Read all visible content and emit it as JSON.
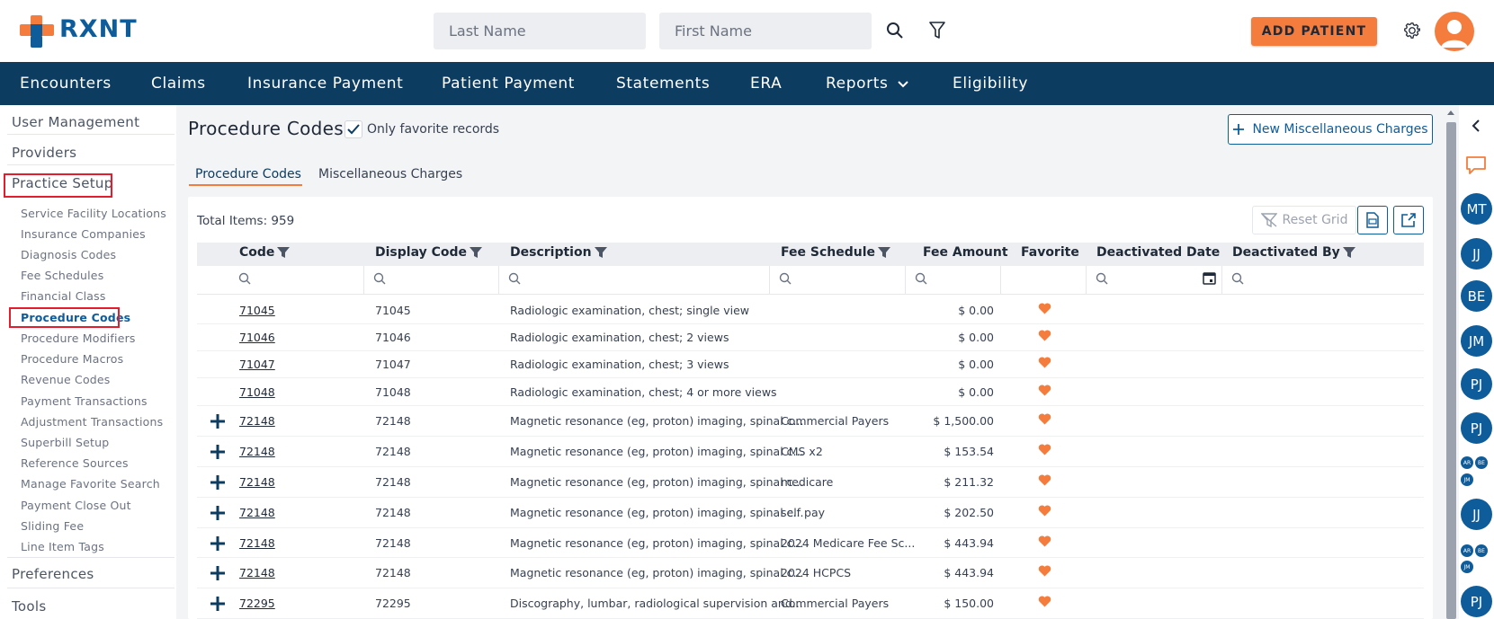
{
  "brand": {
    "name": "RXNT"
  },
  "search": {
    "last_name_placeholder": "Last Name",
    "first_name_placeholder": "First Name"
  },
  "header": {
    "add_patient_label": "ADD PATIENT"
  },
  "nav": {
    "items": [
      "Encounters",
      "Claims",
      "Insurance Payment",
      "Patient Payment",
      "Statements",
      "ERA",
      "Reports",
      "Eligibility"
    ]
  },
  "sidebar": {
    "sections": [
      "User Management",
      "Providers",
      "Practice Setup",
      "Preferences",
      "Tools"
    ],
    "items": [
      "Service Facility Locations",
      "Insurance Companies",
      "Diagnosis Codes",
      "Fee Schedules",
      "Financial Class",
      "Procedure Codes",
      "Procedure Modifiers",
      "Procedure Macros",
      "Revenue Codes",
      "Payment Transactions",
      "Adjustment Transactions",
      "Superbill Setup",
      "Reference Sources",
      "Manage Favorite Search",
      "Payment Close Out",
      "Sliding Fee",
      "Line Item Tags"
    ]
  },
  "main": {
    "title": "Procedure Codes",
    "favorite_label": "Only favorite records",
    "new_misc_label": "New Miscellaneous Charges",
    "tabs": [
      "Procedure Codes",
      "Miscellaneous Charges"
    ],
    "total_items": "Total Items: 959",
    "reset_grid_label": "Reset Grid"
  },
  "grid": {
    "columns": [
      "Code",
      "Display Code",
      "Description",
      "Fee Schedule",
      "Fee Amount",
      "Favorite",
      "Deactivated Date",
      "Deactivated By"
    ],
    "rows": [
      {
        "expand": false,
        "code": "71045",
        "display": "71045",
        "desc": "Radiologic examination, chest; single view",
        "fee_schedule": "",
        "fee": "$ 0.00"
      },
      {
        "expand": false,
        "code": "71046",
        "display": "71046",
        "desc": "Radiologic examination, chest; 2 views",
        "fee_schedule": "",
        "fee": "$ 0.00"
      },
      {
        "expand": false,
        "code": "71047",
        "display": "71047",
        "desc": "Radiologic examination, chest; 3 views",
        "fee_schedule": "",
        "fee": "$ 0.00"
      },
      {
        "expand": false,
        "code": "71048",
        "display": "71048",
        "desc": "Radiologic examination, chest; 4 or more views",
        "fee_schedule": "",
        "fee": "$ 0.00"
      },
      {
        "expand": true,
        "code": "72148",
        "display": "72148",
        "desc": "Magnetic resonance (eg, proton) imaging, spinal c...",
        "fee_schedule": "Commercial Payers",
        "fee": "$ 1,500.00"
      },
      {
        "expand": true,
        "code": "72148",
        "display": "72148",
        "desc": "Magnetic resonance (eg, proton) imaging, spinal c...",
        "fee_schedule": "CMS x2",
        "fee": "$ 153.54"
      },
      {
        "expand": true,
        "code": "72148",
        "display": "72148",
        "desc": "Magnetic resonance (eg, proton) imaging, spinal c...",
        "fee_schedule": "medicare",
        "fee": "$ 211.32"
      },
      {
        "expand": true,
        "code": "72148",
        "display": "72148",
        "desc": "Magnetic resonance (eg, proton) imaging, spinal c...",
        "fee_schedule": "self pay",
        "fee": "$ 202.50"
      },
      {
        "expand": true,
        "code": "72148",
        "display": "72148",
        "desc": "Magnetic resonance (eg, proton) imaging, spinal c...",
        "fee_schedule": "2024 Medicare Fee Sc...",
        "fee": "$ 443.94"
      },
      {
        "expand": true,
        "code": "72148",
        "display": "72148",
        "desc": "Magnetic resonance (eg, proton) imaging, spinal c...",
        "fee_schedule": "2024 HCPCS",
        "fee": "$ 443.94"
      },
      {
        "expand": true,
        "code": "72295",
        "display": "72295",
        "desc": "Discography, lumbar, radiological supervision and...",
        "fee_schedule": "Commercial Payers",
        "fee": "$ 150.00"
      }
    ]
  },
  "rail": {
    "chips": [
      "MT",
      "JJ",
      "BE",
      "JM",
      "PJ",
      "PJ",
      "JJ",
      "PJ"
    ],
    "mini_group_1": [
      "AR",
      "BE",
      "JM"
    ],
    "mini_group_2": [
      "AR",
      "BE",
      "JM"
    ]
  },
  "colors": {
    "accent": "#f47c3c",
    "brand": "#0f5c9a",
    "navbar": "#0d3c61",
    "highlight": "#e11d2e"
  }
}
